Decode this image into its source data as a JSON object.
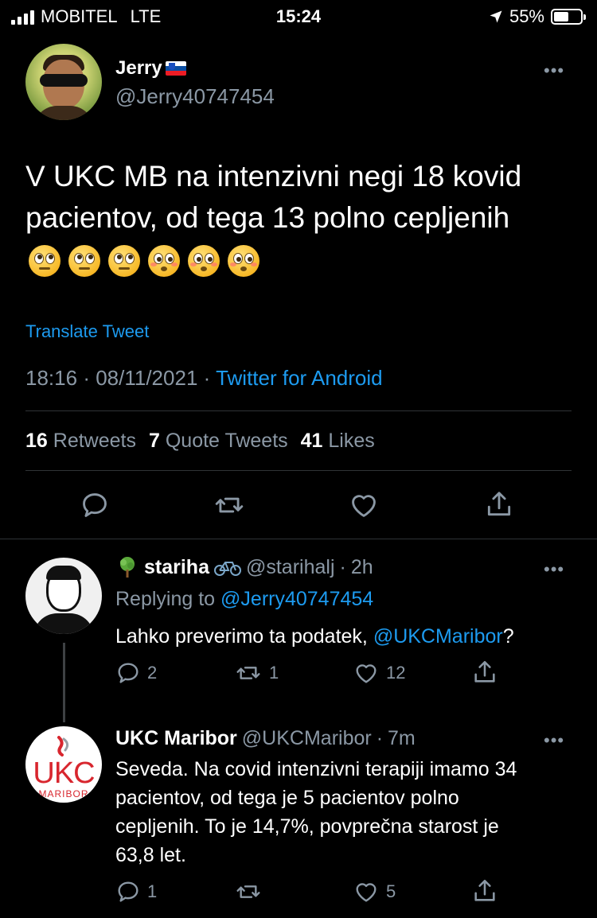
{
  "status_bar": {
    "carrier": "MOBITEL",
    "network": "LTE",
    "time": "15:24",
    "battery": "55%",
    "battery_level": 0.55
  },
  "tweet": {
    "author_name": "Jerry",
    "author_handle": "@Jerry40747454",
    "text": "V UKC MB na intenzivni negi 18 kovid pacientov, od tega 13 polno cepljenih",
    "emojis": [
      "face-with-rolling-eyes",
      "face-with-rolling-eyes",
      "face-with-rolling-eyes",
      "flushed-face",
      "flushed-face",
      "flushed-face"
    ],
    "translate_label": "Translate Tweet",
    "time": "18:16",
    "date": "08/11/2021",
    "source": "Twitter for Android",
    "stats": {
      "retweets_count": "16",
      "retweets_label": "Retweets",
      "quotes_count": "7",
      "quotes_label": "Quote Tweets",
      "likes_count": "41",
      "likes_label": "Likes"
    }
  },
  "replies": [
    {
      "name": "stariha",
      "handle": "@starihalj",
      "age": "2h",
      "replying_prefix": "Replying to",
      "replying_to": "@Jerry40747454",
      "text": "Lahko preverimo ta podatek,",
      "mention": "@UKCMaribor",
      "text_suffix": "?",
      "replies": "2",
      "retweets": "1",
      "likes": "12"
    },
    {
      "name": "UKC Maribor",
      "handle": "@UKCMaribor",
      "age": "7m",
      "text_lines": [
        "Seveda. Na covid intenzivni terapiji imamo 34",
        "pacientov, od tega je 5 pacientov polno",
        "cepljenih. To je 14,7%, povprečna starost je",
        "63,8 let."
      ],
      "avatar_logo": "UKC",
      "avatar_sub": "MARIBOR",
      "replies": "1",
      "retweets": "",
      "likes": "5"
    }
  ],
  "colors": {
    "background": "#000000",
    "link": "#1d9bf0",
    "secondary_text": "#8b98a5",
    "divider": "#2f3336"
  }
}
